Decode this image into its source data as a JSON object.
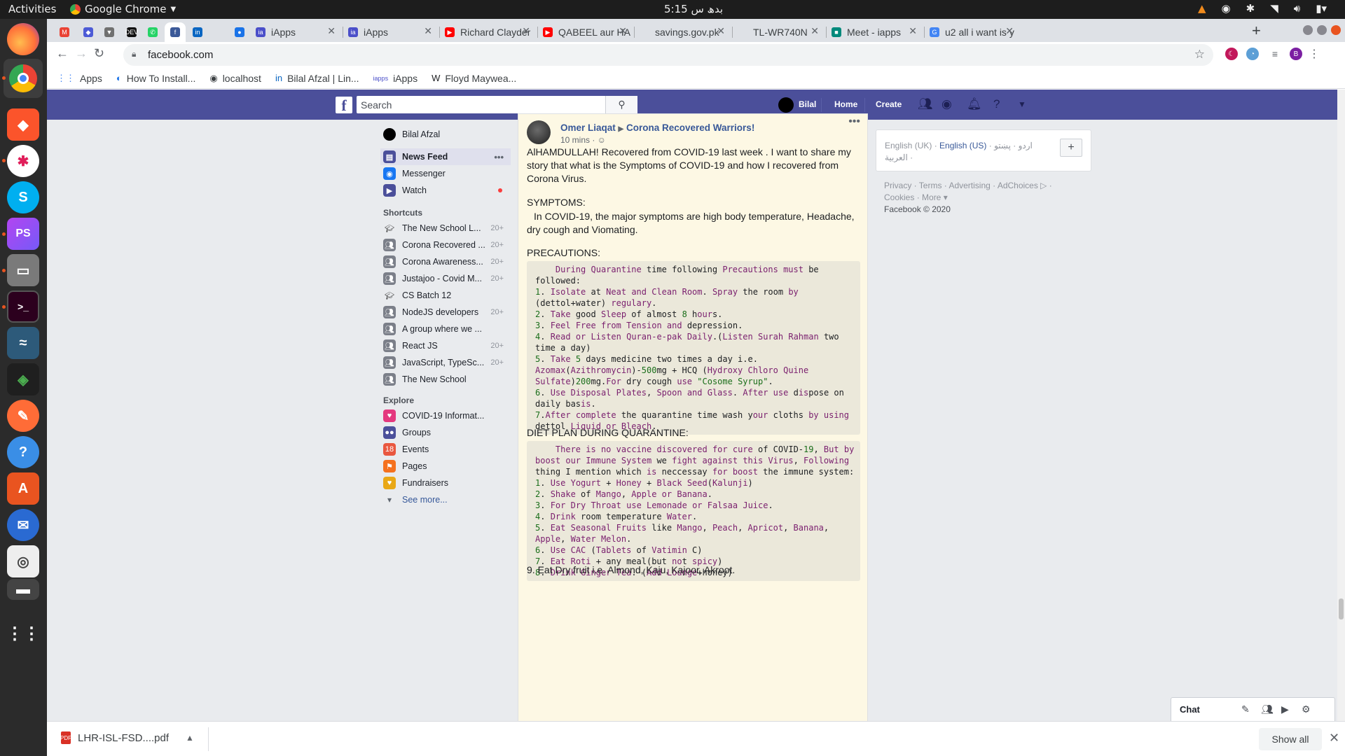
{
  "system_bar": {
    "activities": "Activities",
    "app_name": "Google Chrome",
    "clock": "5:15 بدھ س"
  },
  "browser": {
    "tabs": [
      {
        "title": "",
        "icon": "gmail-icon",
        "color": "#ea4335"
      },
      {
        "title": "",
        "icon": "diamond-icon",
        "color": "#4d5bd6"
      },
      {
        "title": "",
        "icon": "pocket-icon",
        "color": "#707070"
      },
      {
        "title": "",
        "icon": "dev-icon",
        "color": "#111111"
      },
      {
        "title": "",
        "icon": "whatsapp-icon",
        "color": "#25d366"
      },
      {
        "title": "",
        "icon": "facebook-icon",
        "color": "#3b5998"
      },
      {
        "title": "",
        "icon": "linkedin-icon",
        "color": "#0a66c2"
      },
      {
        "title": "",
        "icon": "blank-icon",
        "color": "#dee1e6"
      },
      {
        "title": "",
        "icon": "globe-icon",
        "color": "#1a73e8"
      },
      {
        "title": "iApps",
        "icon": "iapps-icon",
        "color": "#4b4fc9"
      },
      {
        "title": "iApps",
        "icon": "iapps-icon",
        "color": "#4b4fc9"
      },
      {
        "title": "Richard Clayder",
        "icon": "youtube-icon",
        "color": "#ff0000"
      },
      {
        "title": "QABEEL aur HA",
        "icon": "youtube-icon",
        "color": "#ff0000"
      },
      {
        "title": "savings.gov.pk",
        "icon": "blank-icon",
        "color": "#dee1e6"
      },
      {
        "title": "TL-WR740N",
        "icon": "blank-icon",
        "color": "#dee1e6"
      },
      {
        "title": "Meet - iapps",
        "icon": "meet-icon",
        "color": "#00897b"
      },
      {
        "title": "u2 all i want is y",
        "icon": "google-icon",
        "color": "#4285f4"
      }
    ],
    "url": "facebook.com",
    "bookmarks": [
      {
        "label": "Apps",
        "icon": "apps-grid-icon"
      },
      {
        "label": "How To Install...",
        "icon": "blog-icon"
      },
      {
        "label": "localhost",
        "icon": "globe-icon"
      },
      {
        "label": "Bilal Afzal | Lin...",
        "icon": "linkedin-icon"
      },
      {
        "label": "iApps",
        "icon": "iapps-icon"
      },
      {
        "label": "Floyd Maywea...",
        "icon": "wikipedia-icon"
      }
    ],
    "download": {
      "file": "LHR-ISL-FSD....pdf",
      "show_all": "Show all"
    }
  },
  "fb": {
    "search_placeholder": "Search",
    "header": {
      "user": "Bilal",
      "home": "Home",
      "create": "Create"
    },
    "left_nav": {
      "profile": "Bilal Afzal",
      "main": [
        {
          "label": "News Feed",
          "icon": "news-feed-icon",
          "color": "#4b4f9a",
          "selected": true
        },
        {
          "label": "Messenger",
          "icon": "messenger-icon",
          "color": "#1877f2"
        },
        {
          "label": "Watch",
          "icon": "watch-icon",
          "color": "#4b4f9a",
          "dot": true
        }
      ],
      "shortcuts_title": "Shortcuts",
      "shortcuts": [
        {
          "label": "The New School L...",
          "count": "20+",
          "icon": "graduation-cap-icon"
        },
        {
          "label": "Corona Recovered ...",
          "count": "20+",
          "icon": "group-icon"
        },
        {
          "label": "Corona Awareness...",
          "count": "20+",
          "icon": "group-icon"
        },
        {
          "label": "Justajoo - Covid M...",
          "count": "20+",
          "icon": "group-icon"
        },
        {
          "label": "CS Batch 12",
          "count": "",
          "icon": "graduation-cap-icon"
        },
        {
          "label": "NodeJS developers",
          "count": "20+",
          "icon": "group-icon"
        },
        {
          "label": "A group where we ...",
          "count": "",
          "icon": "group-icon"
        },
        {
          "label": "React JS",
          "count": "20+",
          "icon": "group-icon"
        },
        {
          "label": "JavaScript, TypeSc...",
          "count": "20+",
          "icon": "group-icon"
        },
        {
          "label": "The New School",
          "count": "",
          "icon": "group-icon"
        }
      ],
      "explore_title": "Explore",
      "explore": [
        {
          "label": "COVID-19 Informat...",
          "icon": "covid-info-icon",
          "color": "#e4387e"
        },
        {
          "label": "Groups",
          "icon": "groups-icon",
          "color": "#4b4f9a"
        },
        {
          "label": "Events",
          "icon": "calendar-icon",
          "color": "#e9573f"
        },
        {
          "label": "Pages",
          "icon": "flag-icon",
          "color": "#f5711e"
        },
        {
          "label": "Fundraisers",
          "icon": "heart-icon",
          "color": "#e9a816"
        }
      ],
      "see_more": "See more..."
    },
    "post": {
      "author": "Omer Liaqat",
      "group": "Corona Recovered Warriors!",
      "time": "10 mins · ☺",
      "intro": "AlHAMDULLAH! Recovered from COVID-19 last week . I want to share my story that what is the Symptoms of COVID-19 and how I recovered from Corona Virus.",
      "symptoms_title": "SYMPTOMS:",
      "symptoms": "In COVID-19, the major symptoms are high body temperature, Headache, dry cough and Viomating.",
      "precautions_title": "PRECAUTIONS:",
      "precautions_code": [
        "    During Quarantine time following Precautions must be",
        "followed:",
        "1. Isolate at Neat and Clean Room. Spray the room by",
        "(dettol+water) regulary.",
        "2. Take good Sleep of almost 8 hours.",
        "3. Feel Free from Tension and depression.",
        "4. Read or Listen Quran-e-pak Daily.(Listen Surah Rahman two",
        "time a day)",
        "5. Take 5 days medicine two times a day i.e.",
        "Azomax(Azithromycin)-500mg + HCQ (Hydroxy Chloro Quine",
        "Sulfate)200mg.For dry cough use \"Cosome Syrup\".",
        "6. Use Disposal Plates, Spoon and Glass. After use dispose on",
        "daily basis.",
        "7.After complete the quarantine time wash your cloths by using",
        "dettol Liquid or Bleach."
      ],
      "diet_title": "DIET PLAN DURING QUARANTINE:",
      "diet_code": [
        "    There is no vaccine discovered for cure of COVID-19, But by",
        "boost our Immune System we fight against this Virus, Following",
        "thing I mention which is neccessay for boost the immune system:",
        "1. Use Yogurt + Honey + Black Seed(Kalunji)",
        "2. Shake of Mango, Apple or Banana.",
        "3. For Dry Throat use Lemonade or Falsaa Juice.",
        "4. Drink room temperature Water.",
        "5. Eat Seasonal Fruits like Mango, Peach, Apricot, Banana,",
        "Apple, Water Melon.",
        "6. Use CAC (Tablets of Vatimin C)",
        "7. Eat Roti + any meal(but not spicy)",
        "8. Drink Ginger Tea. (Add Lounge+honey)"
      ],
      "last_line": "9. Eat Dry fruit i.e. Almond, Kaju, Kajoor, Akroot."
    },
    "right": {
      "lang_line1_a": "English (UK) · ",
      "lang_line1_b": "English (US)",
      "lang_line1_c": " · اردو · پښتو",
      "lang_line2": "العربية ·",
      "footer1": "Privacy · Terms · Advertising · AdChoices ▷ ·",
      "footer2": "Cookies · More ▾",
      "footer3": "Facebook © 2020"
    },
    "chat": {
      "title": "Chat"
    }
  },
  "colors": {
    "fb_header": "#4b4f9a",
    "post_bg": "#fdf8e4",
    "link": "#385898",
    "code_bg": "#ebe8da"
  }
}
